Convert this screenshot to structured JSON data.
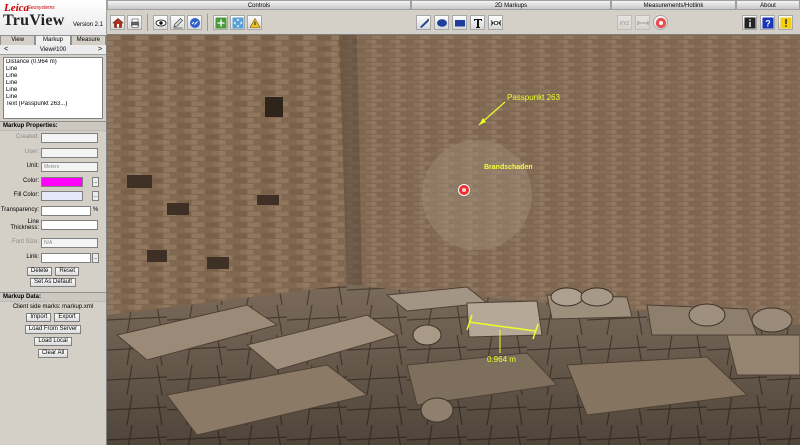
{
  "logo": {
    "brand": "Leica",
    "sub": "Geosystems",
    "product": "TruView",
    "version": "Version 2.1"
  },
  "toolbar": {
    "controls": {
      "title": "Controls",
      "icons": [
        "home-icon",
        "print-icon",
        "eye-icon",
        "pencil-markup-icon",
        "link-icon",
        "plus-zoom-icon",
        "pan-arrows-icon",
        "warning-icon"
      ]
    },
    "markups_2d": {
      "title": "2D Markups",
      "icons": [
        "line-tool-icon",
        "ellipse-tool-icon",
        "rectangle-tool-icon",
        "text-tool-icon",
        "line-segment-tool-icon"
      ]
    },
    "measurements": {
      "title": "Measurements/Hotlink",
      "icons": [
        "xyz-measure-icon",
        "distance-measure-icon",
        "hotlink-icon"
      ]
    },
    "about": {
      "title": "About",
      "icons": [
        "info-icon",
        "help-icon",
        "notice-icon"
      ]
    }
  },
  "left_panel": {
    "tabs": [
      {
        "label": "View",
        "active": false
      },
      {
        "label": "Markup",
        "active": true
      },
      {
        "label": "Measure",
        "active": false
      }
    ],
    "view_name": "View#100",
    "prev": "<",
    "next": ">",
    "markup_list": [
      "Distance (0.964 m)",
      "Line",
      "Line",
      "Line",
      "Line",
      "Line",
      "Text (Passpunkt 263...)"
    ],
    "properties": {
      "title": "Markup Properties:",
      "created_label": "Created:",
      "user_label": "User:",
      "unit_label": "Unit:",
      "unit_value": "Meters",
      "color_label": "Color:",
      "color_value": "#ff00ff",
      "fill_label": "Fill Color:",
      "fill_value": "#e4e8f8",
      "transparency_label": "Transparency:",
      "transparency_unit": "%",
      "thickness_label": "Line Thickness:",
      "font_label": "Font Size:",
      "font_value": "N/A",
      "link_label": "Link:",
      "more": "...",
      "delete": "Delete",
      "reset": "Reset",
      "set_default": "Set As Default"
    },
    "data": {
      "title": "Markup Data:",
      "note": "Client side marks: markup.xml",
      "import": "Import",
      "export": "Export",
      "load_server": "Load From Server",
      "load_local": "Load Local",
      "clear_all": "Clear All"
    }
  },
  "scene": {
    "label_passpunkt": "Passpunkt 263",
    "label_brand": "Brandschaden",
    "label_distance": "0.964 m",
    "markup_color": "#e8ff2a",
    "brand_color": "#f4ff3a"
  }
}
